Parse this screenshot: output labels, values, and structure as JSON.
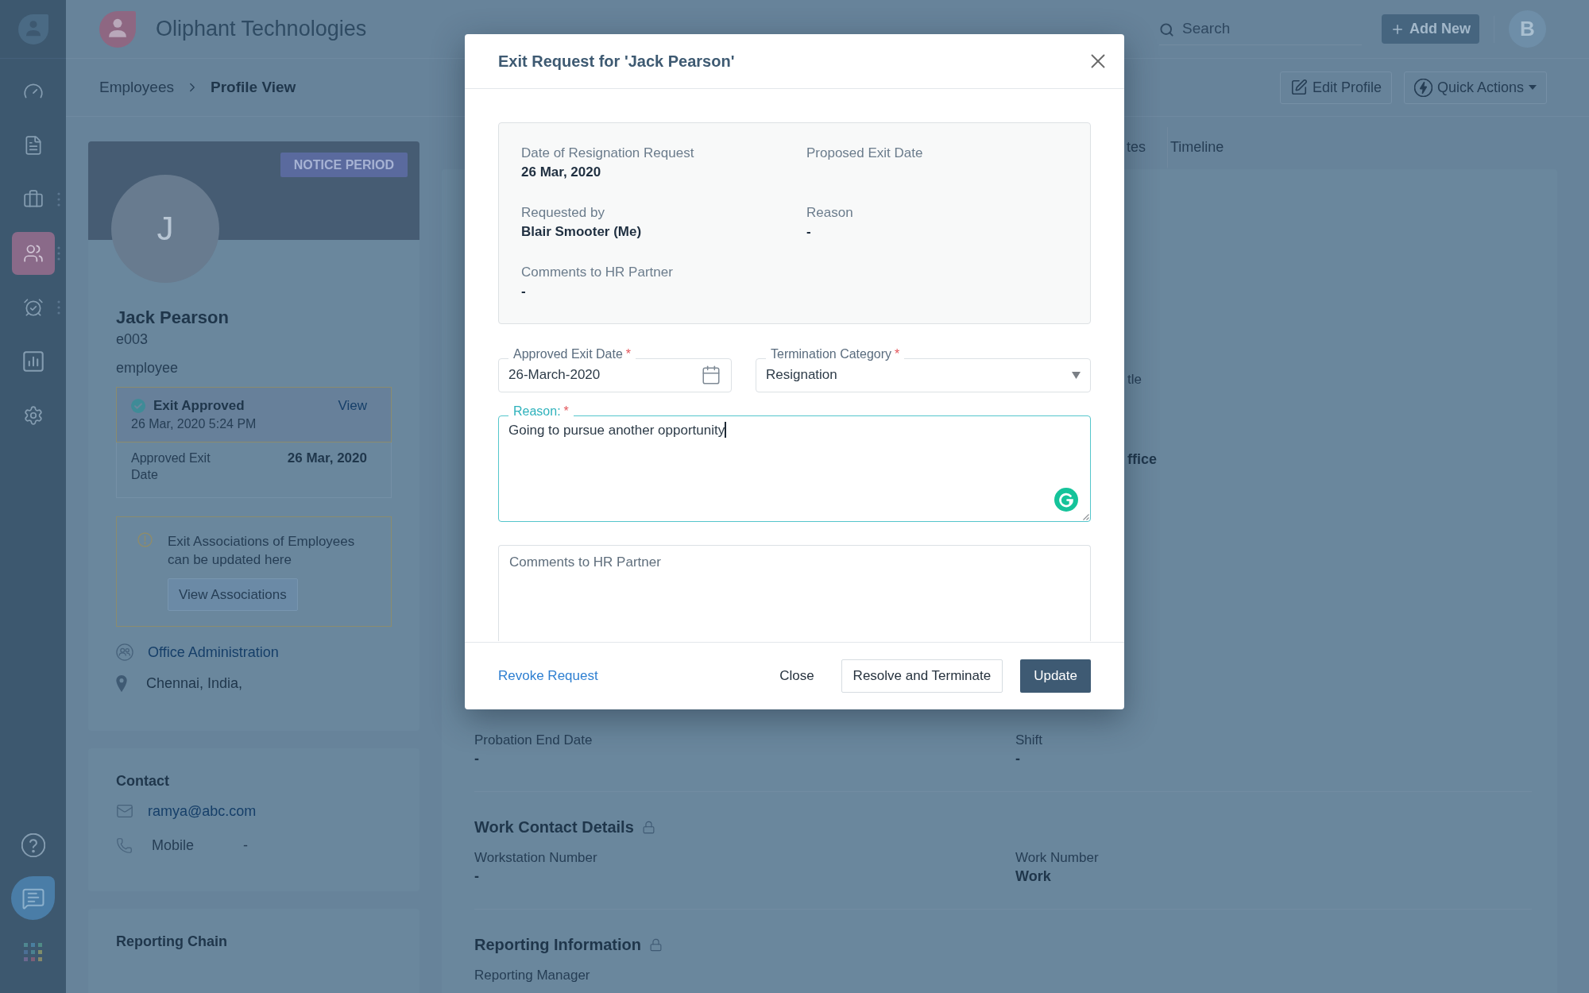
{
  "sidebar": {
    "items": [
      {
        "selected": false,
        "submenu": false
      },
      {
        "selected": false,
        "submenu": false
      },
      {
        "selected": false,
        "submenu": true
      },
      {
        "selected": true,
        "submenu": true
      },
      {
        "selected": false,
        "submenu": true
      },
      {
        "selected": false,
        "submenu": false
      },
      {
        "selected": false,
        "submenu": false
      }
    ]
  },
  "header": {
    "company": "Oliphant Technologies",
    "search": {
      "placeholder": "Search"
    },
    "add_button": "Add New",
    "avatar_initial": "B"
  },
  "breadcrumb": {
    "items": [
      "Employees",
      "Profile View"
    ],
    "actions": [
      "Edit Profile",
      "Quick Actions"
    ]
  },
  "profile": {
    "badge": "NOTICE PERIOD",
    "initial": "J",
    "name": "Jack Pearson",
    "employee_id": "e003",
    "role": "employee",
    "exit": {
      "status": "Exit Approved",
      "time": "26 Mar, 2020 5:24 PM",
      "link": "View",
      "detail_label": "Approved Exit Date",
      "detail_value": "26 Mar, 2020"
    },
    "notice": {
      "text": "Exit Associations of Employees can be updated here",
      "button": "View Associations"
    },
    "department": "Office Administration",
    "location": "Chennai, India,"
  },
  "contact": {
    "title": "Contact",
    "email": "ramya@abc.com",
    "phone_label": "Mobile",
    "phone_value": "-"
  },
  "reporting_chain": {
    "title": "Reporting Chain"
  },
  "tabs": [
    {
      "label": "tes",
      "selected": false
    },
    {
      "label": "Timeline",
      "selected": false
    }
  ],
  "partial_fields": [
    {
      "kind": "label",
      "text": "tle"
    },
    {
      "kind": "value",
      "text": "ffice"
    }
  ],
  "sections": [
    {
      "fields": [
        {
          "label": "Probation End Date",
          "value": "-"
        },
        {
          "label": "Shift",
          "value": "-"
        }
      ]
    },
    {
      "title": "Work Contact Details",
      "locked": true,
      "fields": [
        {
          "label": "Workstation Number",
          "value": "-"
        },
        {
          "label": "Work Number",
          "value": "Work"
        }
      ]
    },
    {
      "title": "Reporting Information",
      "locked": true,
      "fields": [
        {
          "label": "Reporting Manager"
        }
      ]
    }
  ],
  "modal": {
    "title": "Exit Request for 'Jack Pearson'",
    "summary": [
      {
        "label": "Date of Resignation Request",
        "value": "26 Mar, 2020"
      },
      {
        "label": "Proposed Exit Date"
      },
      {
        "label": "Requested by",
        "value": "Blair Smooter (Me)"
      },
      {
        "label": "Reason",
        "value": "-"
      },
      {
        "label": "Comments to HR Partner",
        "value": "-"
      }
    ],
    "approved_exit_date": {
      "label": "Approved Exit Date",
      "required_mark": "*",
      "value": "26-March-2020"
    },
    "termination_category": {
      "label": "Termination Category",
      "required_mark": "*",
      "value": "Resignation"
    },
    "reason": {
      "label": "Reason:",
      "required_mark": "*",
      "value": "Going to pursue another opportunity",
      "focused": true
    },
    "comments": {
      "placeholder": "Comments to HR Partner"
    },
    "revoke_link": "Revoke Request",
    "buttons": [
      {
        "label": "Close",
        "kind": "plain"
      },
      {
        "label": "Resolve and Terminate",
        "kind": "outline"
      },
      {
        "label": "Update",
        "kind": "primary"
      }
    ]
  }
}
